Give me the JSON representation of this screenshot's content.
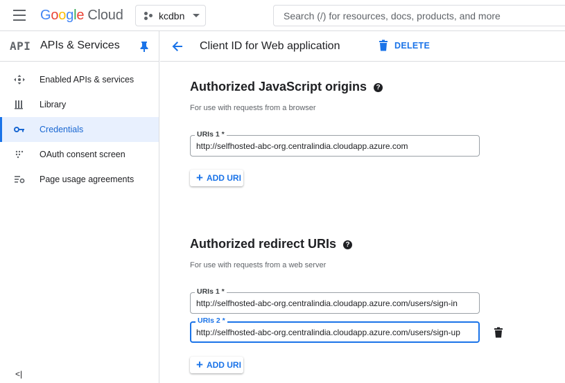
{
  "topbar": {
    "logo_google": [
      "G",
      "o",
      "o",
      "g",
      "l",
      "e"
    ],
    "logo_cloud": "Cloud",
    "project": "kcdbn",
    "search_placeholder": "Search (/) for resources, docs, products, and more"
  },
  "sidebar": {
    "api_logo": "API",
    "title": "APIs & Services",
    "items": [
      {
        "label": "Enabled APIs & services",
        "icon": "apis-icon",
        "active": false
      },
      {
        "label": "Library",
        "icon": "library-icon",
        "active": false
      },
      {
        "label": "Credentials",
        "icon": "key-icon",
        "active": true
      },
      {
        "label": "OAuth consent screen",
        "icon": "oauth-icon",
        "active": false
      },
      {
        "label": "Page usage agreements",
        "icon": "settings-list-icon",
        "active": false
      }
    ],
    "collapse_label": "<|"
  },
  "main": {
    "title": "Client ID for Web application",
    "delete_label": "DELETE",
    "js_origins": {
      "title": "Authorized JavaScript origins",
      "help": "?",
      "hint": "For use with requests from a browser",
      "uris": [
        {
          "label": "URIs 1 *",
          "value": "http://selfhosted-abc-org.centralindia.cloudapp.azure.com"
        }
      ],
      "add_label": "ADD URI"
    },
    "redirect_uris": {
      "title": "Authorized redirect URIs",
      "help": "?",
      "hint": "For use with requests from a web server",
      "uris": [
        {
          "label": "URIs 1 *",
          "value": "http://selfhosted-abc-org.centralindia.cloudapp.azure.com/users/sign-in"
        },
        {
          "label": "URIs 2 *",
          "value": "http://selfhosted-abc-org.centralindia.cloudapp.azure.com/users/sign-up"
        }
      ],
      "add_label": "ADD URI"
    }
  },
  "colors": {
    "accent": "#1a73e8",
    "active_bg": "#e8f0fe",
    "border": "#dadce0",
    "text": "#202124",
    "muted": "#5f6368"
  }
}
